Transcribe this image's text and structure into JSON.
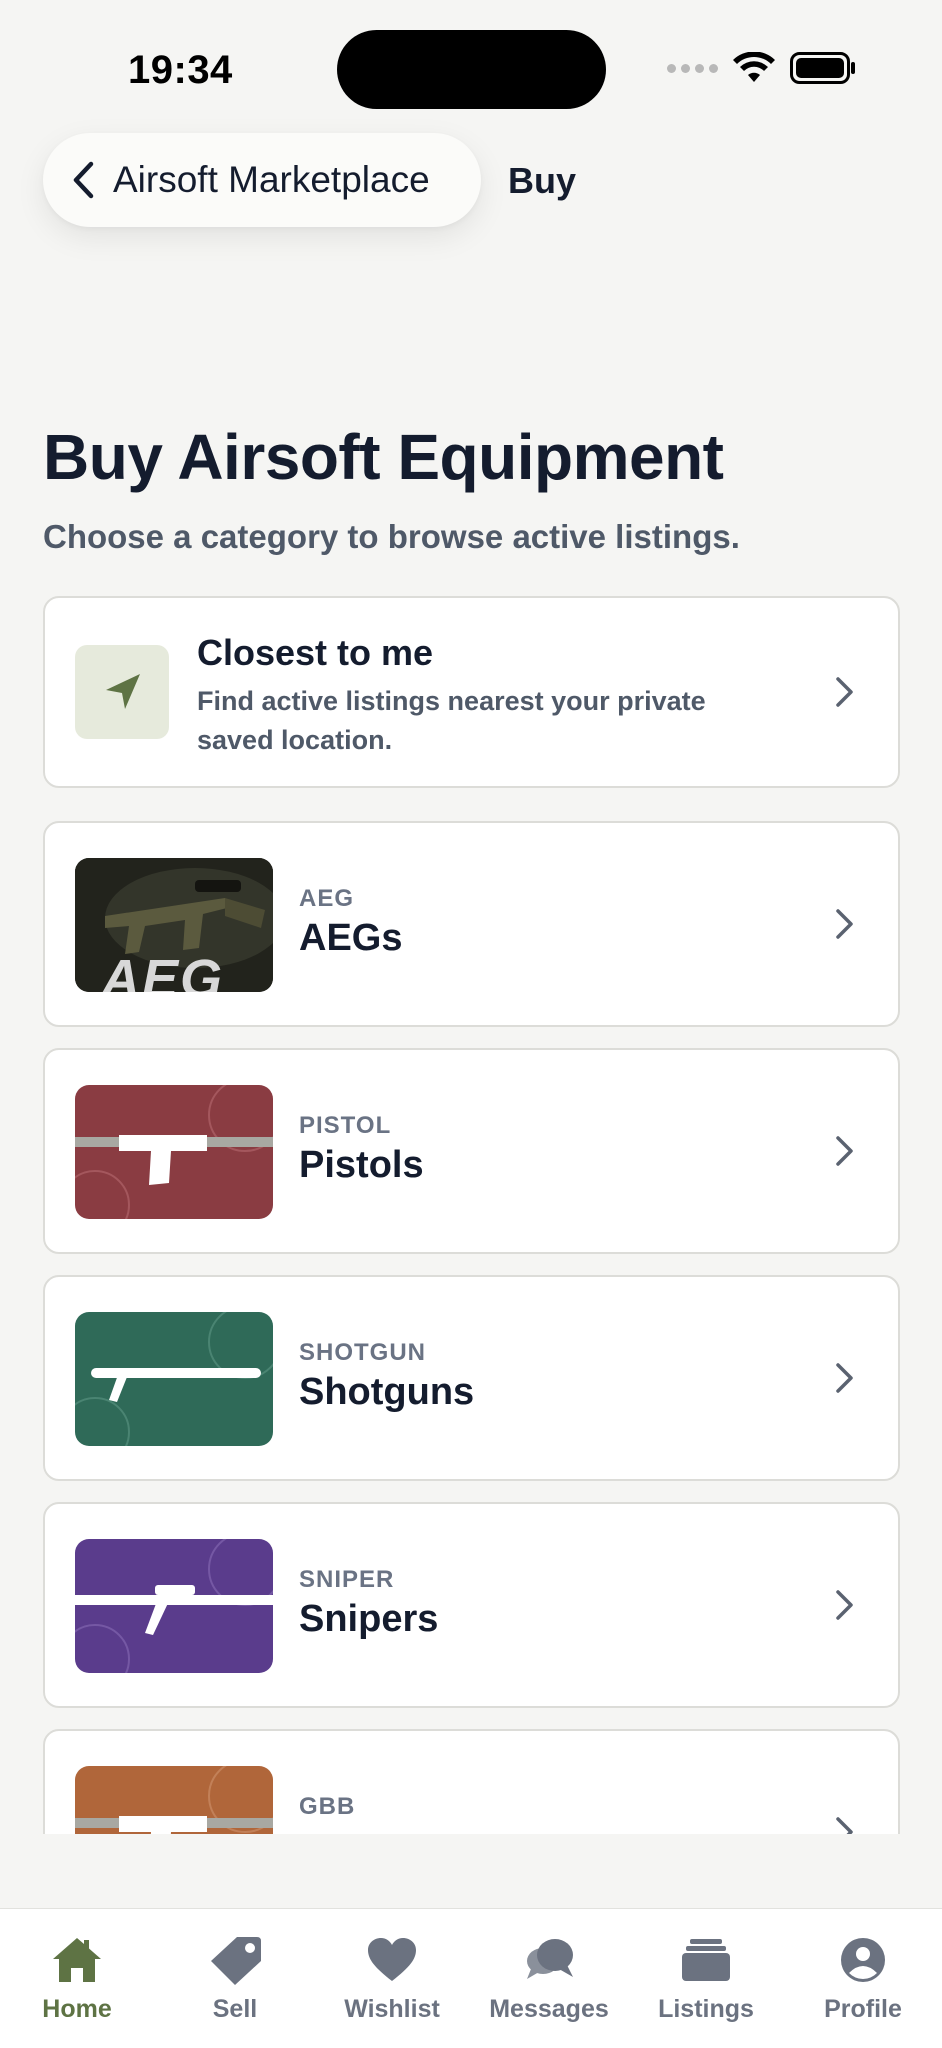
{
  "status_bar": {
    "time": "19:34"
  },
  "nav": {
    "back_label": "Airsoft Marketplace",
    "title": "Buy"
  },
  "header": {
    "title": "Buy Airsoft Equipment",
    "subtitle": "Choose a category to browse active listings."
  },
  "closest": {
    "title": "Closest to me",
    "description": "Find active listings nearest your private saved location.",
    "icon": "location-arrow-icon"
  },
  "categories": [
    {
      "code": "AEG",
      "name": "AEGs",
      "thumb_text": "AEG",
      "color": "#2a2a22"
    },
    {
      "code": "PISTOL",
      "name": "Pistols",
      "color": "#8a3c42"
    },
    {
      "code": "SHOTGUN",
      "name": "Shotguns",
      "color": "#2f6a58"
    },
    {
      "code": "SNIPER",
      "name": "Snipers",
      "color": "#5a3c8c"
    },
    {
      "code": "GBB",
      "name": "",
      "color": "#b0663a"
    }
  ],
  "tabs": [
    {
      "label": "Home",
      "icon": "home-icon",
      "active": true
    },
    {
      "label": "Sell",
      "icon": "tag-icon"
    },
    {
      "label": "Wishlist",
      "icon": "heart-icon"
    },
    {
      "label": "Messages",
      "icon": "chat-bubbles-icon"
    },
    {
      "label": "Listings",
      "icon": "stack-icon"
    },
    {
      "label": "Profile",
      "icon": "person-circle-icon"
    }
  ],
  "colors": {
    "accent": "#5e7344",
    "text_primary": "#141c2e",
    "text_secondary": "#4f5968",
    "background": "#f5f5f3"
  }
}
